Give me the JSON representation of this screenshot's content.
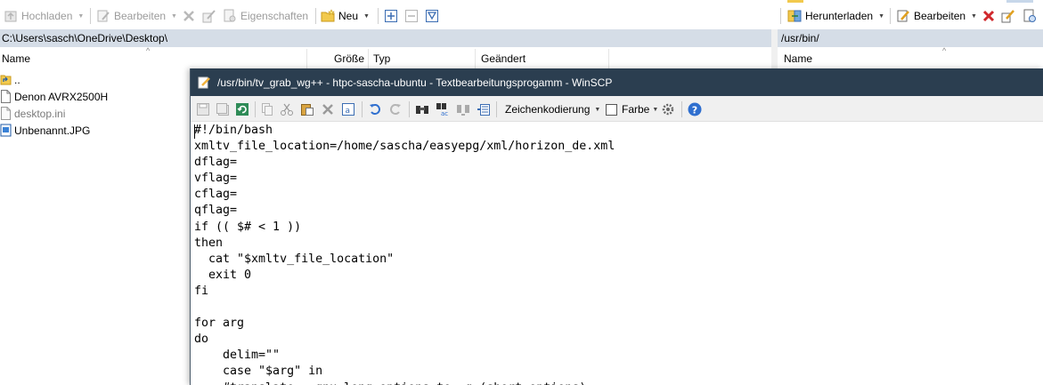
{
  "toolbar": {
    "upload_label": "Hochladen",
    "edit_label": "Bearbeiten",
    "properties_label": "Eigenschaften",
    "new_label": "Neu",
    "download_label": "Herunterladen",
    "edit_right_label": "Bearbeiten"
  },
  "left_panel": {
    "path": "C:\\Users\\sasch\\OneDrive\\Desktop\\",
    "columns": {
      "name": "Name",
      "size": "Größe",
      "type": "Typ",
      "changed": "Geändert"
    },
    "files": [
      {
        "name": "..",
        "icon": "parent-dir-icon"
      },
      {
        "name": "Denon AVRX2500H",
        "icon": "file-icon"
      },
      {
        "name": "desktop.ini",
        "icon": "file-icon",
        "grey": true
      },
      {
        "name": "Unbenannt.JPG",
        "icon": "image-file-icon"
      }
    ]
  },
  "right_panel": {
    "path": "/usr/bin/",
    "columns": {
      "name": "Name"
    }
  },
  "editor": {
    "title": "/usr/bin/tv_grab_wg++ - htpc-sascha-ubuntu - Textbearbeitungsprogamm - WinSCP",
    "encoding_label": "Zeichenkodierung",
    "color_label": "Farbe",
    "code_lines": [
      "#!/bin/bash",
      "xmltv_file_location=/home/sascha/easyepg/xml/horizon_de.xml",
      "dflag=",
      "vflag=",
      "cflag=",
      "qflag=",
      "if (( $# < 1 ))",
      "then",
      "  cat \"$xmltv_file_location\"",
      "  exit 0",
      "fi",
      "",
      "for arg",
      "do",
      "    delim=\"\"",
      "    case \"$arg\" in",
      "    #translate --gnu-long-options to -g (short options)"
    ]
  },
  "colors": {
    "path_bar": "#d5dde7",
    "editor_title_bar": "#2b3e50",
    "editor_title_text": "#ffffff",
    "delete_red": "#d0282c",
    "help_blue": "#2f6fcf"
  }
}
